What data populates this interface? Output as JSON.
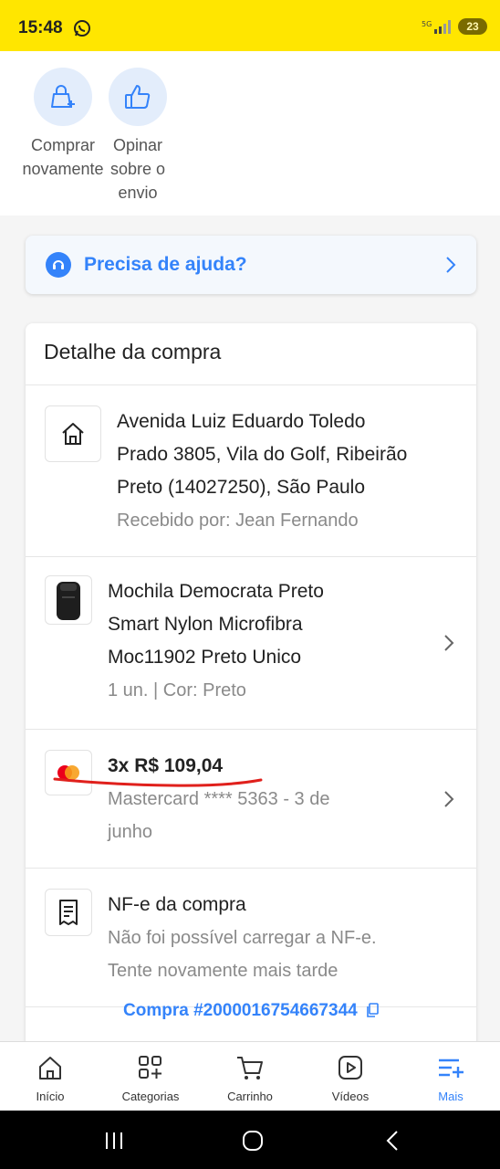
{
  "status_bar": {
    "time": "15:48",
    "battery": "23",
    "network": "5G"
  },
  "quick_actions": [
    {
      "label_line1": "Comprar",
      "label_line2": "novamente",
      "icon": "bag-plus-icon"
    },
    {
      "label_line1": "Opinar",
      "label_line2": "sobre o",
      "label_line3": "envio",
      "icon": "thumbs-up-icon"
    }
  ],
  "help": {
    "label": "Precisa de ajuda?"
  },
  "detail": {
    "title": "Detalhe da compra",
    "address": {
      "line1": "Avenida Luiz Eduardo Toledo",
      "line2": "Prado 3805, Vila do Golf, Ribeirão",
      "line3": "Preto (14027250), São Paulo",
      "received_by": "Recebido por: Jean Fernando"
    },
    "product": {
      "line1": "Mochila Democrata Preto",
      "line2": "Smart Nylon Microfibra",
      "line3": "Moc11902 Preto Unico",
      "meta": "1 un. | Cor: Preto"
    },
    "payment": {
      "amount": "3x R$ 109,04",
      "card_line1": "Mastercard **** 5363 - 3 de",
      "card_line2": "junho",
      "brand_colors": {
        "red": "#eb001b",
        "orange": "#f79e1b",
        "annotation": "#e0201c"
      }
    },
    "invoice": {
      "title": "NF-e da compra",
      "line1": "Não foi possível carregar a NF-e.",
      "line2": "Tente novamente mais tarde"
    },
    "order_link": "Compra #2000016754667344"
  },
  "bottom_nav": [
    {
      "label": "Início",
      "icon": "home-icon"
    },
    {
      "label": "Categorias",
      "icon": "categories-icon"
    },
    {
      "label": "Carrinho",
      "icon": "cart-icon"
    },
    {
      "label": "Vídeos",
      "icon": "video-icon"
    },
    {
      "label": "Mais",
      "icon": "menu-plus-icon",
      "active": true
    }
  ],
  "colors": {
    "brand_yellow": "#ffe600",
    "accent_blue": "#3483fa"
  }
}
